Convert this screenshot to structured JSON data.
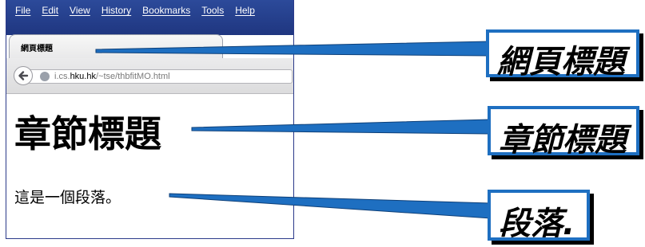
{
  "browser": {
    "menu": [
      "File",
      "Edit",
      "View",
      "History",
      "Bookmarks",
      "Tools",
      "Help"
    ],
    "tab_title": "網頁標題",
    "url_prefix": "i.cs.",
    "url_host": "hku.hk",
    "url_path": "/~tse/thbfitMO.html"
  },
  "page": {
    "heading": "章節標題",
    "paragraph": "這是一個段落。"
  },
  "callouts": {
    "title_label": "網頁標題",
    "heading_label": "章節標題",
    "paragraph_label": "段落."
  },
  "colors": {
    "callout_border": "#1e6fc1",
    "menubar": "#2c4a9a"
  }
}
